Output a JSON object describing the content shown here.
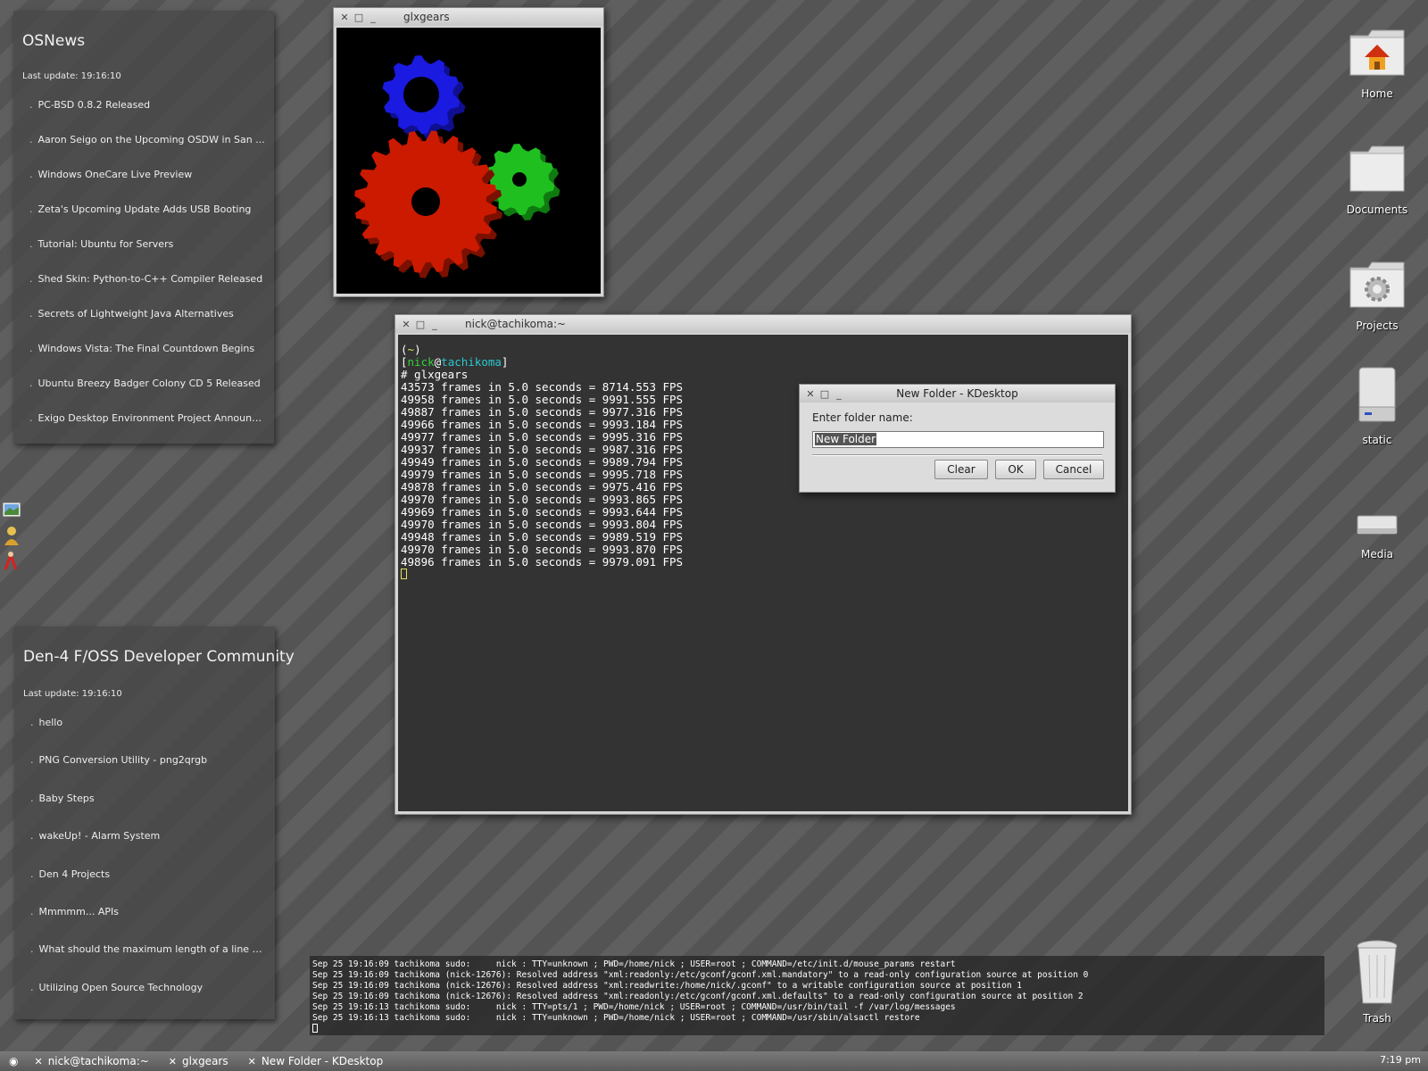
{
  "osnews": {
    "title": "OSNews",
    "last_update": "Last update: 19:16:10",
    "items": [
      "PC-BSD 0.8.2 Released",
      "Aaron Seigo on the Upcoming OSDW in San ...",
      "Windows OneCare Live Preview",
      "Zeta's Upcoming Update Adds USB Booting",
      "Tutorial: Ubuntu for Servers",
      "Shed Skin: Python-to-C++ Compiler Released",
      "Secrets of Lightweight Java Alternatives",
      "Windows Vista: The Final Countdown Begins",
      "Ubuntu Breezy Badger Colony CD 5 Released",
      "Exigo Desktop Environment Project Announced"
    ]
  },
  "den4": {
    "title": "Den-4 F/OSS Developer Community",
    "last_update": "Last update: 19:16:10",
    "items": [
      "hello",
      "PNG Conversion Utility - png2qrgb",
      "Baby Steps",
      "wakeUp! - Alarm System",
      "Den 4 Projects",
      "Mmmmm... APIs",
      "What should the maximum length of a line of...",
      "Utilizing Open Source Technology"
    ]
  },
  "glxgears_window": {
    "title": "glxgears"
  },
  "terminal": {
    "title": "nick@tachikoma:~",
    "prompt_dir": "~",
    "prompt_user": "nick",
    "prompt_host": "tachikoma",
    "command": "# glxgears",
    "output": [
      "43573 frames in 5.0 seconds = 8714.553 FPS",
      "49958 frames in 5.0 seconds = 9991.555 FPS",
      "49887 frames in 5.0 seconds = 9977.316 FPS",
      "49966 frames in 5.0 seconds = 9993.184 FPS",
      "49977 frames in 5.0 seconds = 9995.316 FPS",
      "49937 frames in 5.0 seconds = 9987.316 FPS",
      "49949 frames in 5.0 seconds = 9989.794 FPS",
      "49979 frames in 5.0 seconds = 9995.718 FPS",
      "49878 frames in 5.0 seconds = 9975.416 FPS",
      "49970 frames in 5.0 seconds = 9993.865 FPS",
      "49969 frames in 5.0 seconds = 9993.644 FPS",
      "49970 frames in 5.0 seconds = 9993.804 FPS",
      "49948 frames in 5.0 seconds = 9989.519 FPS",
      "49970 frames in 5.0 seconds = 9993.870 FPS",
      "49896 frames in 5.0 seconds = 9979.091 FPS"
    ]
  },
  "dialog": {
    "title": "New Folder - KDesktop",
    "label": "Enter folder name:",
    "input_value": "New Folder",
    "clear": "Clear",
    "ok": "OK",
    "cancel": "Cancel"
  },
  "desktop_icons": {
    "home": "Home",
    "documents": "Documents",
    "projects": "Projects",
    "static": "static",
    "media": "Media",
    "trash": "Trash"
  },
  "log": [
    "Sep 25 19:16:09 tachikoma sudo:     nick : TTY=unknown ; PWD=/home/nick ; USER=root ; COMMAND=/etc/init.d/mouse_params restart",
    "Sep 25 19:16:09 tachikoma (nick-12676): Resolved address \"xml:readonly:/etc/gconf/gconf.xml.mandatory\" to a read-only configuration source at position 0",
    "Sep 25 19:16:09 tachikoma (nick-12676): Resolved address \"xml:readwrite:/home/nick/.gconf\" to a writable configuration source at position 1",
    "Sep 25 19:16:09 tachikoma (nick-12676): Resolved address \"xml:readonly:/etc/gconf/gconf.xml.defaults\" to a read-only configuration source at position 2",
    "Sep 25 19:16:13 tachikoma sudo:     nick : TTY=pts/1 ; PWD=/home/nick ; USER=root ; COMMAND=/usr/bin/tail -f /var/log/messages",
    "Sep 25 19:16:13 tachikoma sudo:     nick : TTY=unknown ; PWD=/home/nick ; USER=root ; COMMAND=/usr/sbin/alsactl restore"
  ],
  "taskbar": {
    "tasks": [
      "nick@tachikoma:~",
      "glxgears",
      "New Folder - KDesktop"
    ],
    "clock": "7:19 pm"
  },
  "colors": {
    "gear_red": "#cc1a00",
    "gear_green": "#1fbf1f",
    "gear_blue": "#1a1ae0",
    "prompt_green": "#36d13a",
    "prompt_cyan": "#2bc7cf"
  }
}
